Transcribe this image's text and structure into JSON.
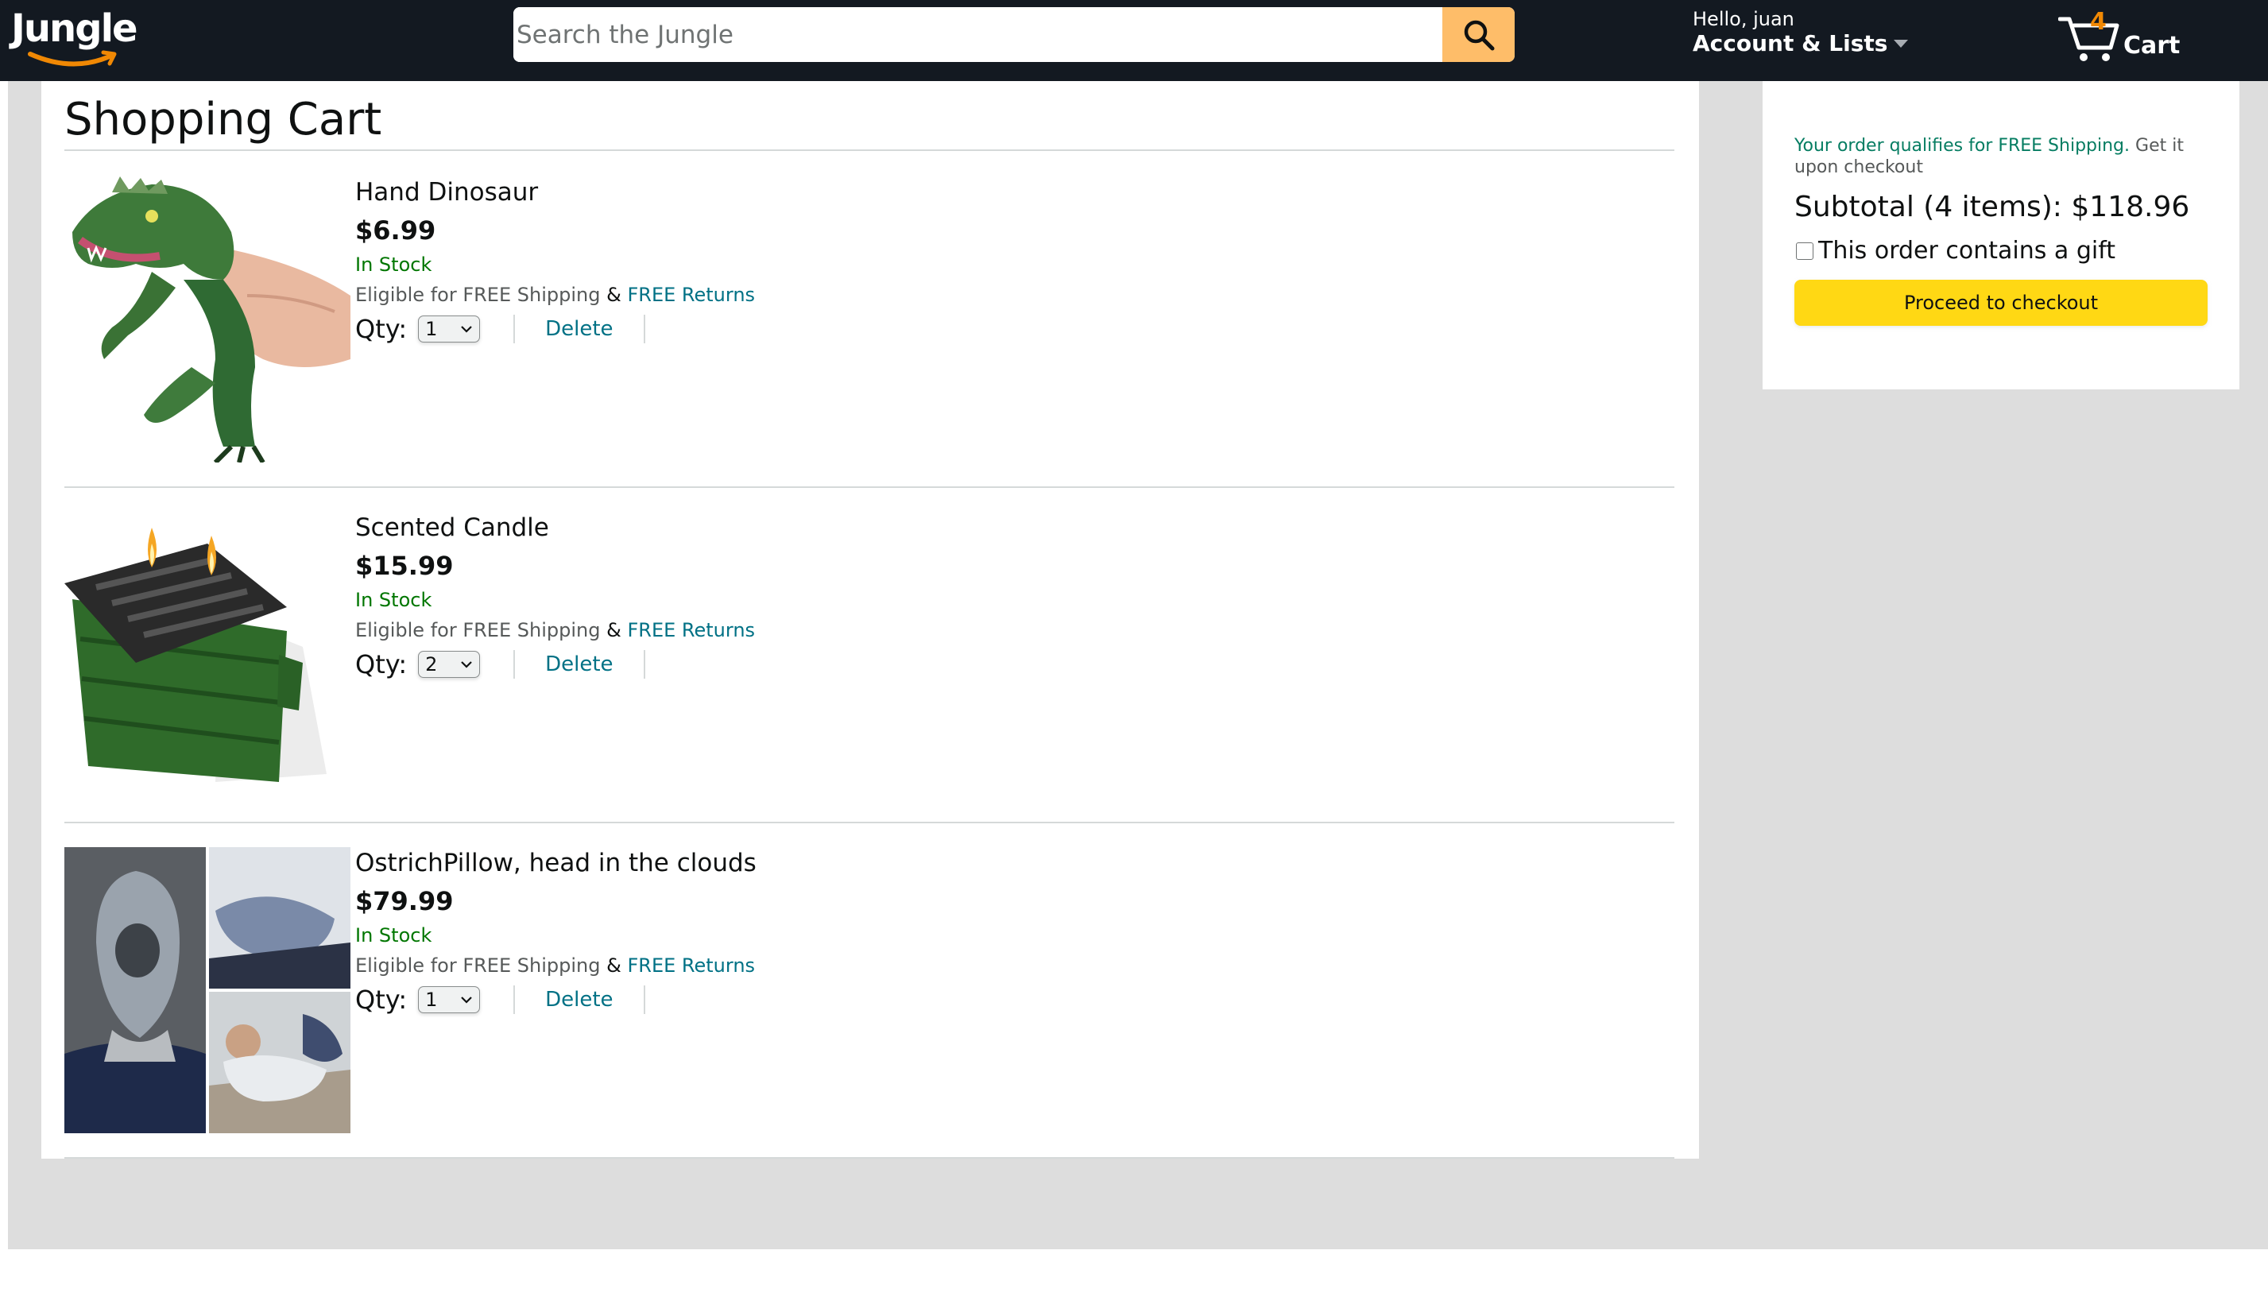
{
  "header": {
    "logo": "Jungle",
    "search_placeholder": "Search the Jungle",
    "greeting": "Hello, juan",
    "account_lists": "Account & Lists",
    "cart_count": "4",
    "cart_label": "Cart"
  },
  "cart": {
    "title": "Shopping Cart",
    "items": [
      {
        "name": "Hand Dinosaur",
        "price": "$6.99",
        "stock": "In Stock",
        "shipping": "Eligible for FREE Shipping",
        "amp": "&",
        "returns": "FREE Returns",
        "qty_label": "Qty:",
        "qty": "1",
        "delete": "Delete"
      },
      {
        "name": "Scented Candle",
        "price": "$15.99",
        "stock": "In Stock",
        "shipping": "Eligible for FREE Shipping",
        "amp": "&",
        "returns": "FREE Returns",
        "qty_label": "Qty:",
        "qty": "2",
        "delete": "Delete"
      },
      {
        "name": "OstrichPillow, head in the clouds",
        "price": "$79.99",
        "stock": "In Stock",
        "shipping": "Eligible for FREE Shipping",
        "amp": "&",
        "returns": "FREE Returns",
        "qty_label": "Qty:",
        "qty": "1",
        "delete": "Delete"
      }
    ]
  },
  "summary": {
    "free_shipping": "Your order qualifies for FREE Shipping.",
    "get_it": "Get it upon checkout",
    "subtotal": "Subtotal (4 items): $118.96",
    "gift_label": "This order contains a gift",
    "checkout_label": "Proceed to checkout"
  },
  "colors": {
    "navbar": "#131921",
    "search_button": "#febd69",
    "cart_count": "#f08804",
    "in_stock": "#007600",
    "link": "#007185",
    "checkout_button": "#ffd814",
    "page_bg": "#dddddd"
  }
}
